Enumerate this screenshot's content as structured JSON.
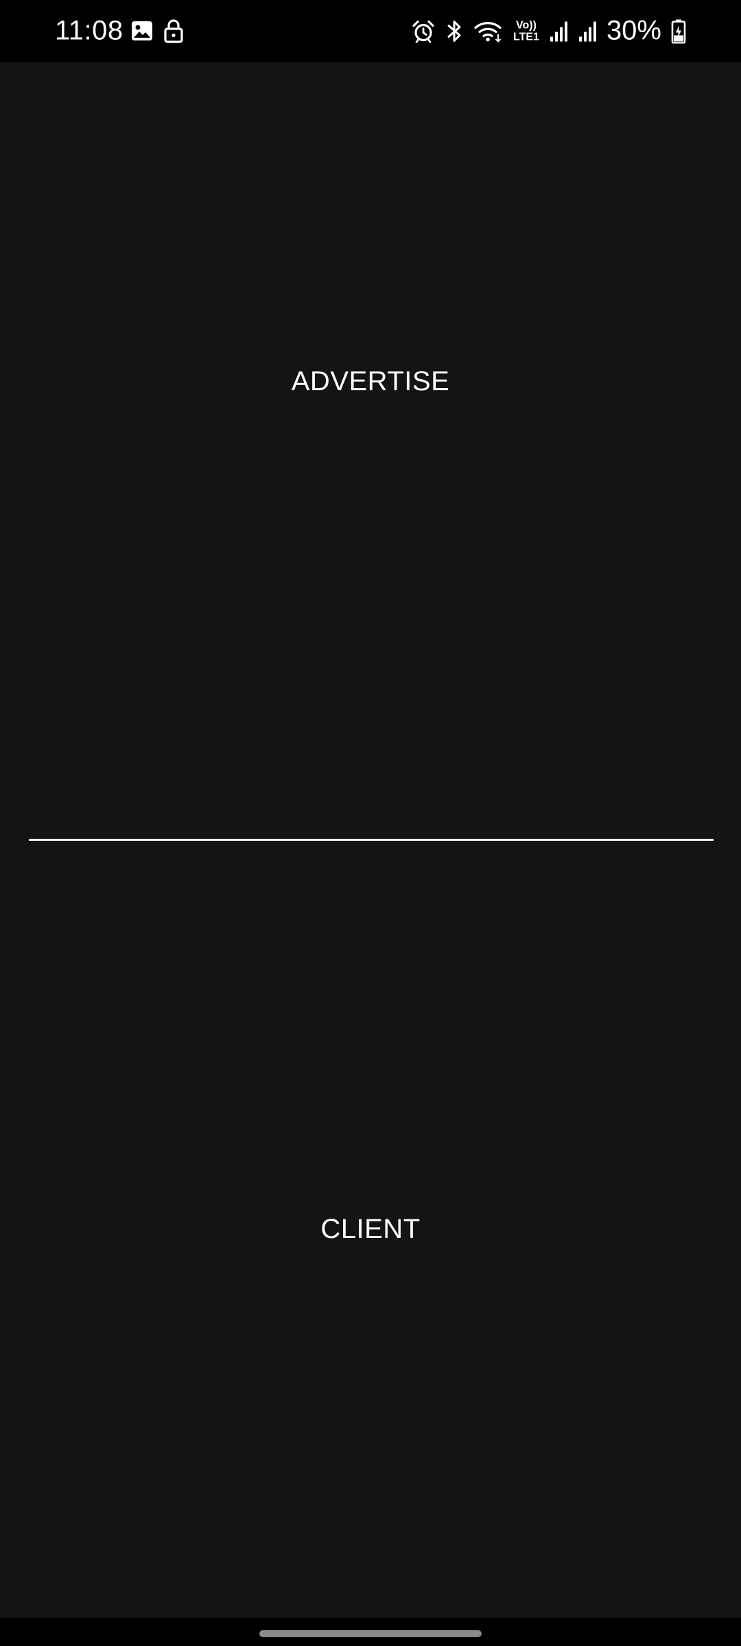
{
  "status_bar": {
    "time": "11:08",
    "network_lines": [
      "Vo))",
      "LTE1"
    ],
    "battery_percent": "30%",
    "icons": [
      "gallery-icon",
      "lock-icon",
      "alarm-icon",
      "bluetooth-icon",
      "wifi-icon",
      "signal-icon",
      "signal-icon",
      "battery-charging-icon"
    ]
  },
  "main": {
    "advertise_label": "ADVERTISE",
    "client_label": "CLIENT"
  },
  "colors": {
    "background": "#141414",
    "status_bar": "#000000",
    "text": "#ffffff",
    "divider": "#f2f2f2"
  }
}
